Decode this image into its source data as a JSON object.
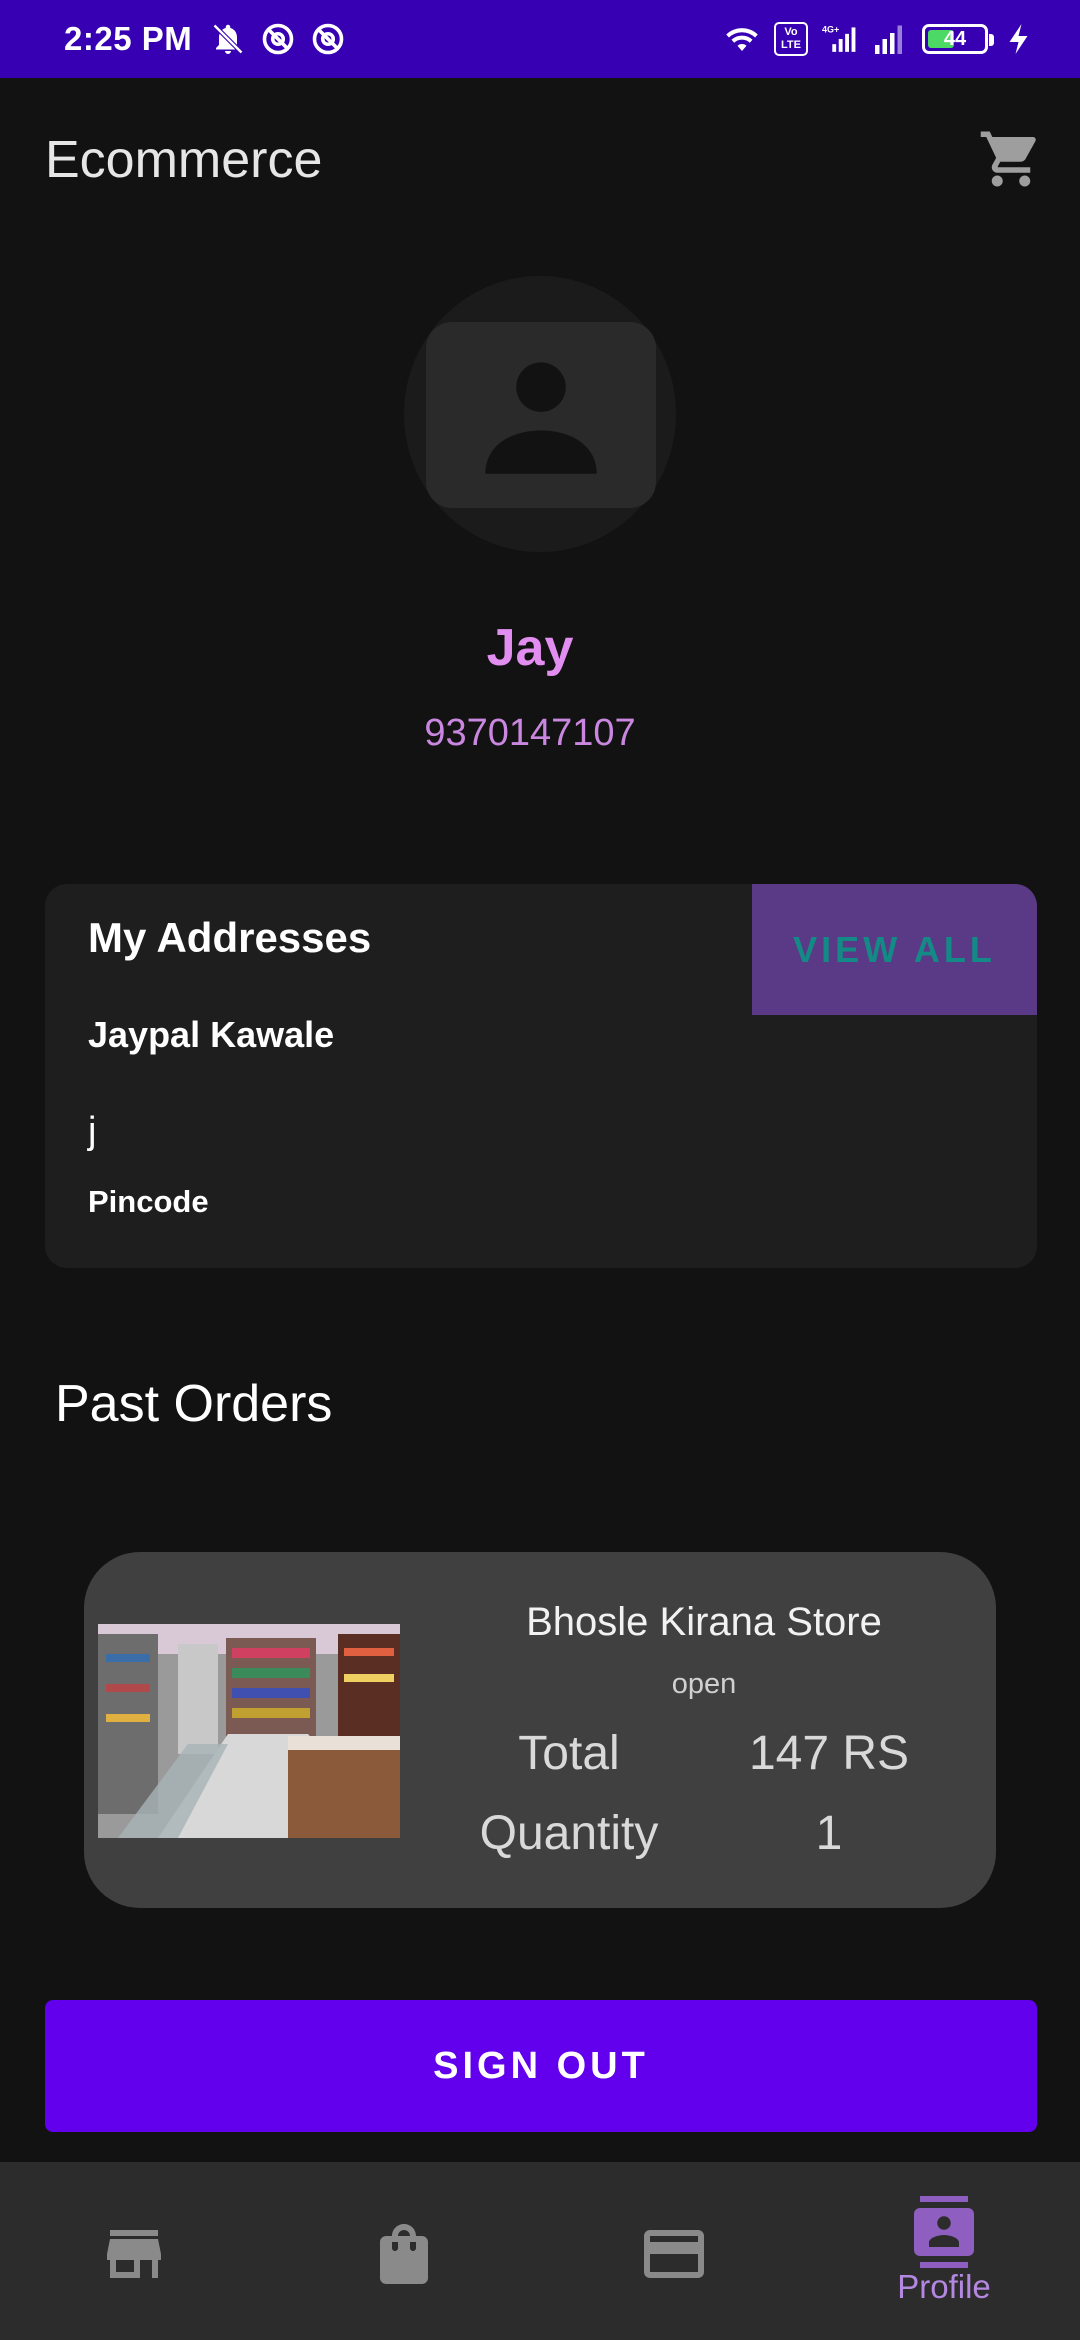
{
  "status_bar": {
    "time": "2:25 PM",
    "battery_level": "44",
    "network": "4G+",
    "volte": "Vo LTE"
  },
  "app_bar": {
    "title": "Ecommerce",
    "cart_icon": "cart-icon"
  },
  "profile": {
    "avatar_icon": "person-placeholder-icon",
    "name": "Jay",
    "phone": "9370147107"
  },
  "addresses": {
    "title": "My Addresses",
    "view_all_label": "VIEW ALL",
    "name": "Jaypal Kawale",
    "line": "j",
    "pincode_label": "Pincode"
  },
  "past_orders": {
    "title": "Past Orders",
    "orders": [
      {
        "store": "Bhosle Kirana Store",
        "status": "open",
        "total_label": "Total",
        "total_value": "147 RS",
        "quantity_label": "Quantity",
        "quantity_value": "1"
      }
    ]
  },
  "sign_out_label": "SIGN OUT",
  "bottom_nav": {
    "items": [
      {
        "icon": "store-icon",
        "label": ""
      },
      {
        "icon": "shopping-bag-icon",
        "label": ""
      },
      {
        "icon": "credit-card-icon",
        "label": ""
      },
      {
        "icon": "profile-icon",
        "label": "Profile"
      }
    ],
    "active": "Profile"
  },
  "colors": {
    "status_bar": "#3700b3",
    "background": "#121212",
    "accent_pink": "#e28ef0",
    "button_primary": "#6200ee",
    "view_all_bg": "#5a3a86",
    "view_all_text": "#138a85",
    "active_nav": "#b487e0"
  }
}
